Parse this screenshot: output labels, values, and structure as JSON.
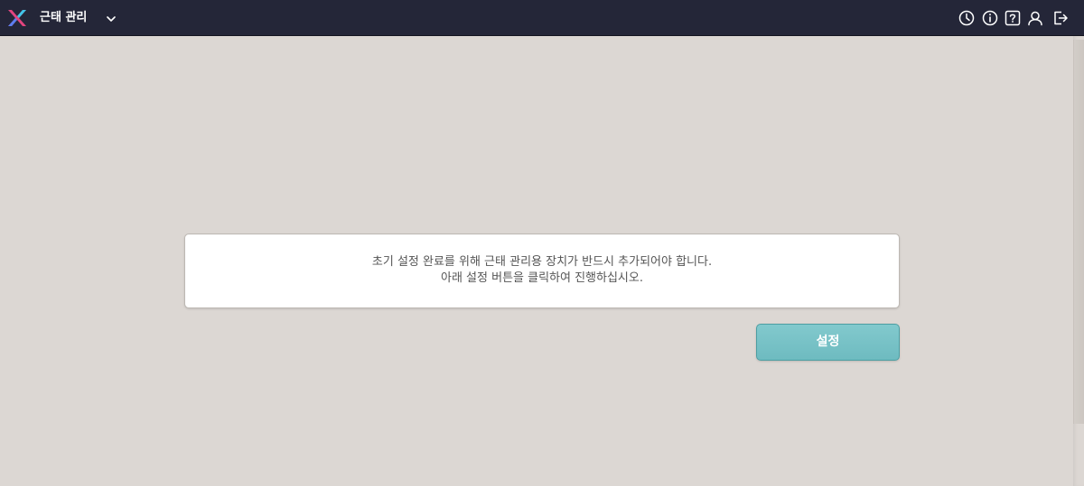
{
  "header": {
    "app_title": "근태 관리",
    "icons": [
      "clock-icon",
      "info-icon",
      "help-icon",
      "user-icon",
      "logout-icon"
    ]
  },
  "main": {
    "message_line1": "초기 설정 완료를 위해 근태 관리용 장치가 반드시 추가되어야 합니다.",
    "message_line2": "아래 설정 버튼을 클릭하여 진행하십시오.",
    "setup_button_label": "설정"
  },
  "colors": {
    "header_bg": "#242638",
    "page_bg": "#dcd7d3",
    "button_accent": "#78c3c7"
  }
}
